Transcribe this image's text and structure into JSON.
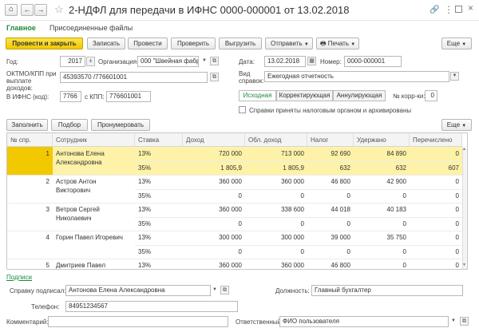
{
  "window": {
    "title": "2-НДФЛ для передачи в ИФНС 0000-000001 от 13.02.2018"
  },
  "nav_tabs": {
    "main": "Главное",
    "files": "Присоединенные файлы"
  },
  "toolbar": {
    "post_close": "Провести и закрыть",
    "save": "Записать",
    "post": "Провести",
    "check": "Проверить",
    "export": "Выгрузить",
    "send": "Отправить",
    "print": "Печать",
    "more": "Еще"
  },
  "form": {
    "year_label": "Год:",
    "year": "2017",
    "org_label": "Организация:",
    "org": "000 \"Швейная фабри",
    "date_label": "Дата:",
    "date": "13.02.2018",
    "number_label": "Номер:",
    "number": "0000-000001",
    "oktmo_label": "ОКТМО/КПП при выплате доходов:",
    "oktmo": "45393570 /776601001",
    "kind_label": "Вид справок:",
    "kind": "Ежегодная отчетность",
    "ifns_label": "В ИФНС (код):",
    "ifns": "7766",
    "kpp_label": "с КПП:",
    "kpp": "776601001",
    "tab_orig": "Исходная",
    "tab_corr": "Корректирующая",
    "tab_cancel": "Аннулирующая",
    "corr_num_label": "№ корр-ки:",
    "corr_num": "0",
    "accepted_label": "Справки приняты налоговым органом и архивированы"
  },
  "table_toolbar": {
    "fill": "Заполнить",
    "pick": "Подбор",
    "renumber": "Пронумеровать",
    "more": "Еще"
  },
  "table": {
    "headers": [
      "№ спр.",
      "Сотрудник",
      "Ставка",
      "Доход",
      "Обл. доход",
      "Налог",
      "Удержано",
      "Перечислено"
    ],
    "rows": [
      {
        "num": "1",
        "name1": "Антонова Елена",
        "name2": "Александровна",
        "r1": [
          "13%",
          "720 000",
          "713 000",
          "92 690",
          "84 890",
          "0"
        ],
        "r2": [
          "35%",
          "1 805,9",
          "1 805,9",
          "632",
          "632",
          "607"
        ]
      },
      {
        "num": "2",
        "name1": "Астров Антон",
        "name2": "Викторович",
        "r1": [
          "13%",
          "360 000",
          "360 000",
          "46 800",
          "42 900",
          "0"
        ],
        "r2": [
          "35%",
          "0",
          "0",
          "0",
          "0",
          "0"
        ]
      },
      {
        "num": "3",
        "name1": "Ветров Сергей",
        "name2": "Николаевич",
        "r1": [
          "13%",
          "360 000",
          "338 600",
          "44 018",
          "40 183",
          "0"
        ],
        "r2": [
          "35%",
          "0",
          "0",
          "0",
          "0",
          "0"
        ]
      },
      {
        "num": "4",
        "name1": "Горин Павел Игоревич",
        "name2": "",
        "r1": [
          "13%",
          "300 000",
          "300 000",
          "39 000",
          "35 750",
          "0"
        ],
        "r2": [
          "35%",
          "0",
          "0",
          "0",
          "0",
          "0"
        ]
      },
      {
        "num": "5",
        "name1": "Дмитриев Павел",
        "name2": "",
        "r1": [
          "13%",
          "360 000",
          "360 000",
          "46 800",
          "0",
          "0"
        ],
        "r2": [
          "",
          "",
          "",
          "",
          "",
          ""
        ]
      }
    ]
  },
  "footer": {
    "signatures_link": "Подписи",
    "signed_label": "Справку подписал:",
    "signed": "Антонова Елена Александровна",
    "position_label": "Должность:",
    "position": "Главный бухгалтер",
    "phone_label": "Телефон:",
    "phone": "84951234567",
    "comment_label": "Комментарий:",
    "comment": "",
    "resp_label": "Ответственный:",
    "resp": "ФИО пользователя"
  }
}
